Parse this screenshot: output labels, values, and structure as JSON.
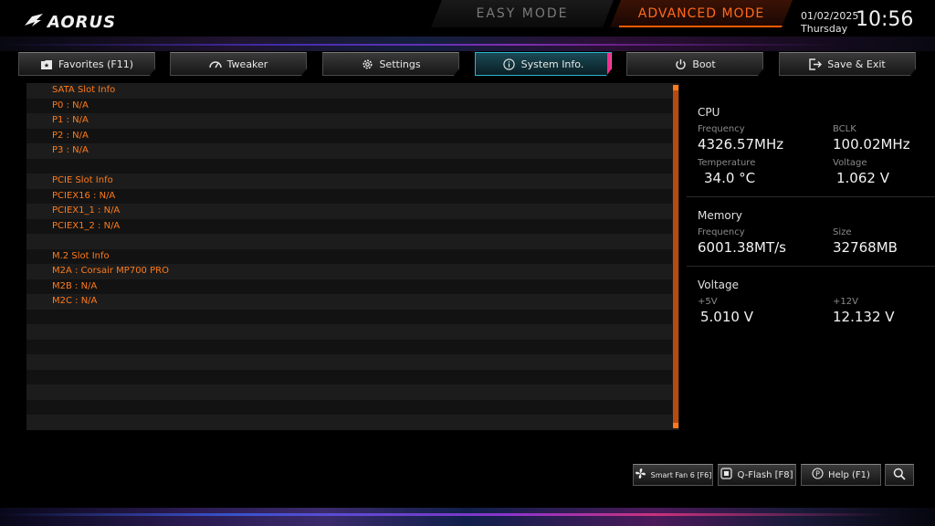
{
  "header": {
    "logo_text": "AORUS",
    "easy_mode": "EASY MODE",
    "advanced_mode": "ADVANCED MODE",
    "date": "01/02/2025",
    "weekday": "Thursday",
    "time": "10:56"
  },
  "tabs": [
    {
      "label": "Favorites (F11)",
      "icon": "favorites-icon"
    },
    {
      "label": "Tweaker",
      "icon": "gauge-icon"
    },
    {
      "label": "Settings",
      "icon": "gear-icon"
    },
    {
      "label": "System Info.",
      "icon": "info-icon",
      "active": true
    },
    {
      "label": "Boot",
      "icon": "power-icon"
    },
    {
      "label": "Save & Exit",
      "icon": "exit-icon"
    }
  ],
  "slot_list": [
    "SATA Slot Info",
    "P0 : N/A",
    "P1 : N/A",
    "P2 : N/A",
    "P3 : N/A",
    "",
    "PCIE Slot Info",
    "PCIEX16 : N/A",
    "PCIEX1_1 : N/A",
    "PCIEX1_2 : N/A",
    "",
    "M.2 Slot Info",
    "M2A : Corsair MP700 PRO",
    "M2B : N/A",
    "M2C : N/A",
    "",
    "",
    "",
    "",
    "",
    "",
    "",
    ""
  ],
  "cpu": {
    "title": "CPU",
    "frequency_label": "Frequency",
    "frequency": "4326.57MHz",
    "bclk_label": "BCLK",
    "bclk": "100.02MHz",
    "temperature_label": "Temperature",
    "temperature": "34.0 °C",
    "voltage_label": "Voltage",
    "voltage": "1.062 V"
  },
  "memory": {
    "title": "Memory",
    "frequency_label": "Frequency",
    "frequency": "6001.38MT/s",
    "size_label": "Size",
    "size": "32768MB"
  },
  "voltage": {
    "title": "Voltage",
    "v5_label": "+5V",
    "v5": "5.010 V",
    "v12_label": "+12V",
    "v12": "12.132 V"
  },
  "bottom_buttons": {
    "smart_fan": "Smart Fan 6 [F6]",
    "qflash": "Q-Flash [F8]",
    "help": "Help (F1)"
  },
  "colors": {
    "accent_orange": "#ff7a1a",
    "active_tab": "#2ab6d0"
  }
}
